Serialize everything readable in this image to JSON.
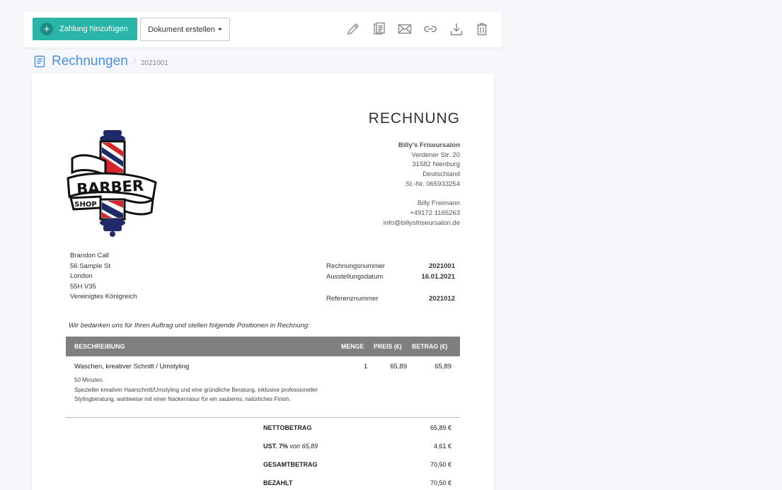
{
  "toolbar": {
    "add_payment_label": "Zahlung hinzufügen",
    "create_document_label": "Dokument erstellen",
    "icons": [
      "pencil-icon",
      "copy-icon",
      "mail-icon",
      "link-icon",
      "download-icon",
      "trash-icon"
    ]
  },
  "breadcrumb": {
    "title": "Rechnungen",
    "separator": "/",
    "id": "2021001"
  },
  "invoice": {
    "title": "RECHNUNG",
    "logo": {
      "line1": "BARBER",
      "line2": "SHOP"
    },
    "sender": {
      "company": "Billy's Friseursalon",
      "street": "Verdener Str. 20",
      "city": "31582 Nienburg",
      "country": "Deutschland",
      "tax": "St.-Nr. 065933254",
      "contact": "Billy Freimann",
      "phone": "+49172 1165263",
      "email": "info@billysfriseursalon.de"
    },
    "recipient": {
      "name": "Brandon Call",
      "street": "56 Sample St",
      "city": "London",
      "postcode": "55H V35",
      "country": "Vereinigtes Königreich"
    },
    "meta": {
      "invoice_no_label": "Rechnungsnummer",
      "invoice_no": "2021001",
      "date_label": "Ausstellungsdatum",
      "date": "16.01.2021",
      "ref_label": "Referenznummer",
      "ref": "2021012"
    },
    "intro": "Wir bedanken uns für Ihren Auftrag und stellen folgende Positionen in Rechnung:",
    "columns": {
      "description": "BESCHREIBUNG",
      "quantity": "MENGE",
      "price": "PREIS (€)",
      "amount": "BETRAG (€)"
    },
    "items": [
      {
        "title": "Waschen, kreativer Schnitt / Umstyling",
        "quantity": "1",
        "price": "65,89",
        "amount": "65,89",
        "duration": "50 Minuten.",
        "note": "Spezieller kreativer Haarschnitt/Umstyling und eine gründliche Beratung, inklusive professioneller Stylingberatung, wahlweise mit einer Nackenrasur für ein sauberes, natürliches Finish."
      }
    ],
    "totals": {
      "net_label": "NETTOBETRAG",
      "net": "65,89 €",
      "vat_label": "UST. 7%",
      "vat_base": "von 65,89",
      "vat": "4,61 €",
      "gross_label": "GESAMTBETRAG",
      "gross": "70,50 €",
      "paid_label": "BEZAHLT",
      "paid": "70,50 €"
    }
  },
  "colors": {
    "accent": "#2bb5a8",
    "link": "#4a8ee0",
    "table_header": "#7f7f7f",
    "logo_navy": "#1f2a6b",
    "logo_red": "#d9232d"
  }
}
